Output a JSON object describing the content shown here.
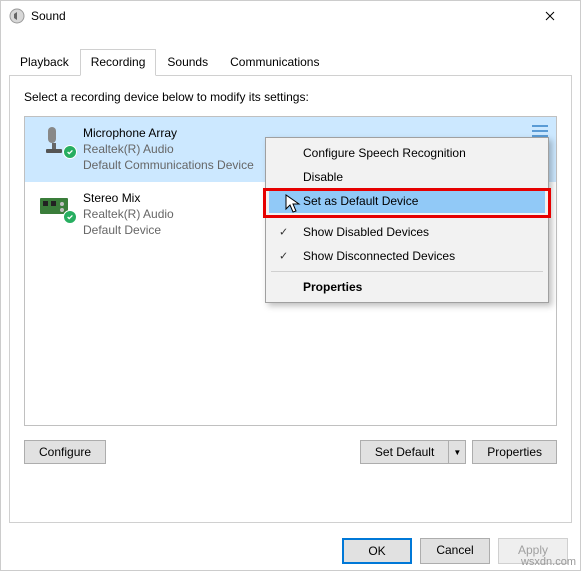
{
  "window": {
    "title": "Sound"
  },
  "tabs": {
    "playback": "Playback",
    "recording": "Recording",
    "sounds": "Sounds",
    "communications": "Communications",
    "active": "recording"
  },
  "instruction": "Select a recording device below to modify its settings:",
  "devices": [
    {
      "name": "Microphone Array",
      "driver": "Realtek(R) Audio",
      "status": "Default Communications Device",
      "selected": true,
      "icon": "microphone"
    },
    {
      "name": "Stereo Mix",
      "driver": "Realtek(R) Audio",
      "status": "Default Device",
      "selected": false,
      "icon": "soundcard"
    }
  ],
  "buttons": {
    "configure": "Configure",
    "set_default": "Set Default",
    "properties": "Properties",
    "ok": "OK",
    "cancel": "Cancel",
    "apply": "Apply"
  },
  "context_menu": {
    "configure_speech": "Configure Speech Recognition",
    "disable": "Disable",
    "set_default": "Set as Default Device",
    "show_disabled": "Show Disabled Devices",
    "show_disconnected": "Show Disconnected Devices",
    "properties": "Properties",
    "checked": {
      "show_disabled": true,
      "show_disconnected": true
    },
    "highlighted": "set_default"
  },
  "watermark": "wsxdn.com"
}
